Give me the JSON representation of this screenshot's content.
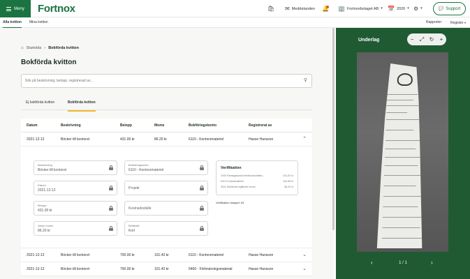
{
  "topbar": {
    "menu_label": "Meny",
    "logo": "Fortnox",
    "messages_label": "Meddelanden",
    "company_label": "Fortnoxbolaget AB",
    "year_label": "2020",
    "support_label": "Support"
  },
  "subnav": {
    "tabs": [
      "Alla kvitton",
      "Mina kvitton"
    ],
    "right": [
      "Rapporter",
      "Register"
    ]
  },
  "breadcrumb": {
    "home": "Startsida",
    "current": "Bokförda kvitton"
  },
  "page_title": "Bokförda kvitton",
  "search": {
    "placeholder": "Sök på beskrivning, belopp, registrerad av..."
  },
  "tabs": [
    "Ej bokförda kvitton",
    "Bokförda kvitton"
  ],
  "table": {
    "headers": [
      "Datum",
      "Beskrivning",
      "Belopp",
      "Moms",
      "Bokföringskonto",
      "Registrerat av"
    ],
    "rows": [
      [
        "2021-12-12",
        "Böcker till kontoret",
        "431.00 kr",
        "86.20 kr",
        "6110 - Kontorsmateriel",
        "Hasse Hansson"
      ],
      [
        "2021-12-12",
        "Böcker till kontoret",
        "700.00 kr",
        "101.43 kr",
        "6110 - Kontorsmateriel",
        "Hasse Hansson"
      ],
      [
        "2021-12-12",
        "Böcker till kontoret",
        "700.00 kr",
        "101.43 kr",
        "5460 - Förbrukningsmaterial",
        "Hasse Hansson"
      ]
    ]
  },
  "detail": {
    "beskrivning": {
      "label": "Beskrivning",
      "value": "Böcker till kontoret"
    },
    "konto": {
      "label": "Bokföringskonto",
      "value": "6110 - Kontorsmateriel"
    },
    "datum": {
      "label": "Datum",
      "value": "2021-12-12"
    },
    "projekt": {
      "placeholder": "Projekt"
    },
    "belopp": {
      "label": "Belopp",
      "value": "431.00 kr"
    },
    "kostnadsstalle": {
      "placeholder": "Kostnadsställe"
    },
    "moms": {
      "label": "Varav moms",
      "value": "86.20 kr"
    },
    "betalsatt": {
      "label": "Betalsätt",
      "value": "Kort"
    },
    "verifikation": {
      "title": "Verifikation",
      "lines": [
        {
          "label": "1930 Företagskonto/checkkonto/affärs...",
          "amount": "431,00 kr"
        },
        {
          "label": "6110 Kontorsmateriel",
          "amount": "344,80 kr"
        },
        {
          "label": "2641 Debiterad ingående moms",
          "amount": "86,20 kr"
        }
      ],
      "link": "Verifikation skapad: #3"
    }
  },
  "document": {
    "title": "Underlag",
    "zoom_labels": [
      "−",
      "⤢",
      "↻",
      "+"
    ],
    "pager": "1 / 1"
  }
}
